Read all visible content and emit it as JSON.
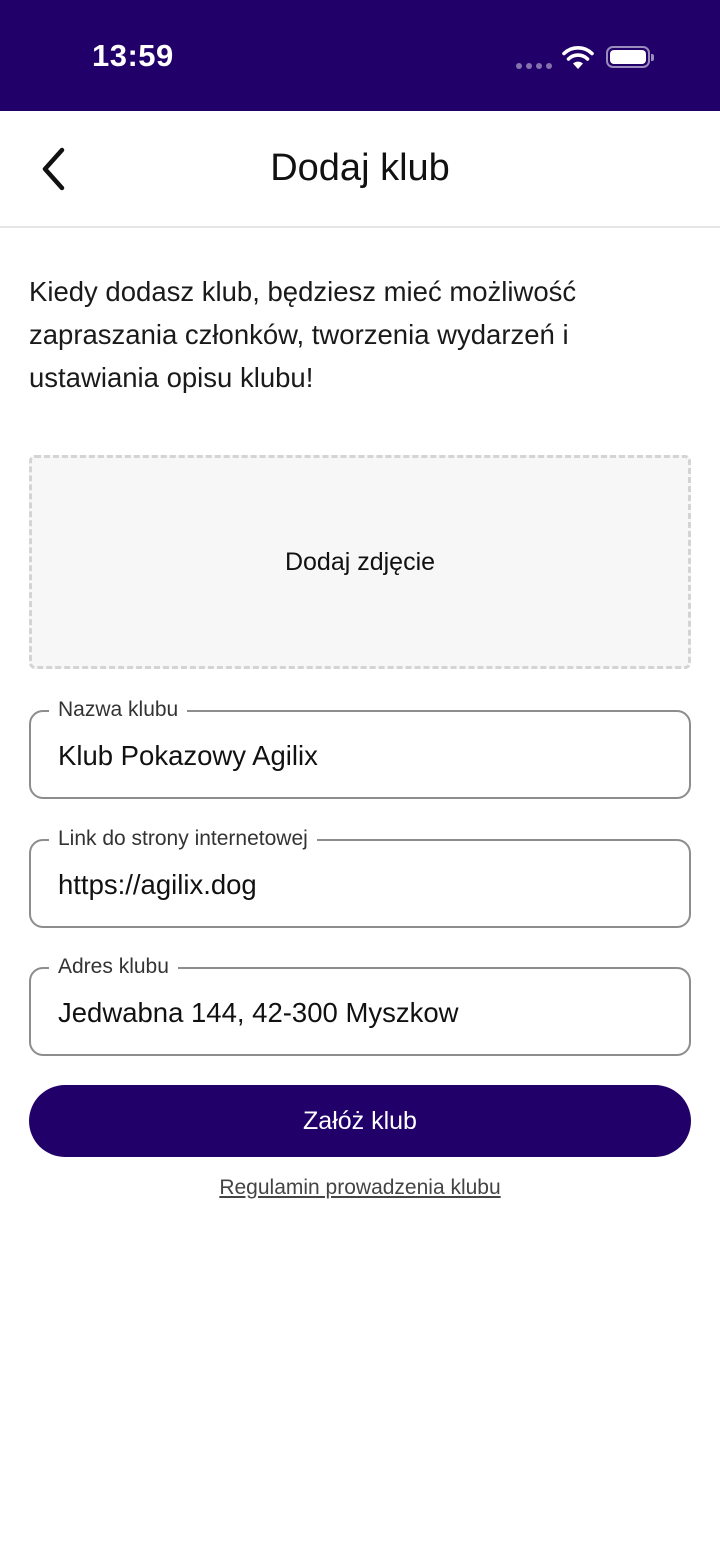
{
  "status_bar": {
    "time": "13:59",
    "icons": [
      "signal-icon",
      "wifi-icon",
      "battery-icon"
    ]
  },
  "header": {
    "title": "Dodaj klub",
    "back_icon": "chevron-left-icon"
  },
  "intro": {
    "text": "Kiedy dodasz klub, będziesz mieć możliwość zapraszania członków, tworzenia wydarzeń i ustawiania opisu klubu!"
  },
  "photo_upload": {
    "label": "Dodaj zdjęcie"
  },
  "form": {
    "club_name": {
      "label": "Nazwa klubu",
      "value": "Klub Pokazowy Agilix"
    },
    "website": {
      "label": "Link do strony internetowej",
      "value": "https://agilix.dog"
    },
    "address": {
      "label": "Adres klubu",
      "value": "Jedwabna 144, 42-300 Myszkow"
    }
  },
  "actions": {
    "submit_label": "Załóż klub",
    "terms_link": "Regulamin prowadzenia klubu"
  },
  "colors": {
    "brand": "#21006a",
    "field_border": "#8d8d8d",
    "dashed_border": "#d4d4d4"
  }
}
